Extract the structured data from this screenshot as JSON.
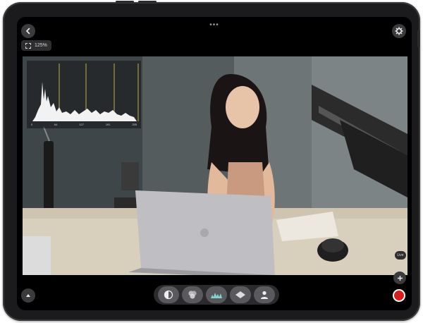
{
  "top_bar": {
    "back_icon": "chevron-left-icon",
    "more_icon": "more-dots-icon",
    "settings_icon": "gear-icon"
  },
  "zoom": {
    "label": "125%",
    "icon": "expand-icon"
  },
  "histogram": {
    "ticks": [
      "0",
      "64",
      "127",
      "191",
      "255"
    ]
  },
  "side_chip": {
    "label": "Live"
  },
  "toolbar": {
    "tools": [
      {
        "name": "exposure-tool",
        "icon": "half-circle-icon"
      },
      {
        "name": "color-wheels-tool",
        "icon": "color-wheels-icon"
      },
      {
        "name": "histogram-tool",
        "icon": "waveform-icon"
      },
      {
        "name": "vectorscope-tool",
        "icon": "vectorscope-icon"
      },
      {
        "name": "subject-tool",
        "icon": "person-icon"
      }
    ]
  },
  "colors": {
    "record": "#d91c1c",
    "accent": "#e8d14a"
  }
}
